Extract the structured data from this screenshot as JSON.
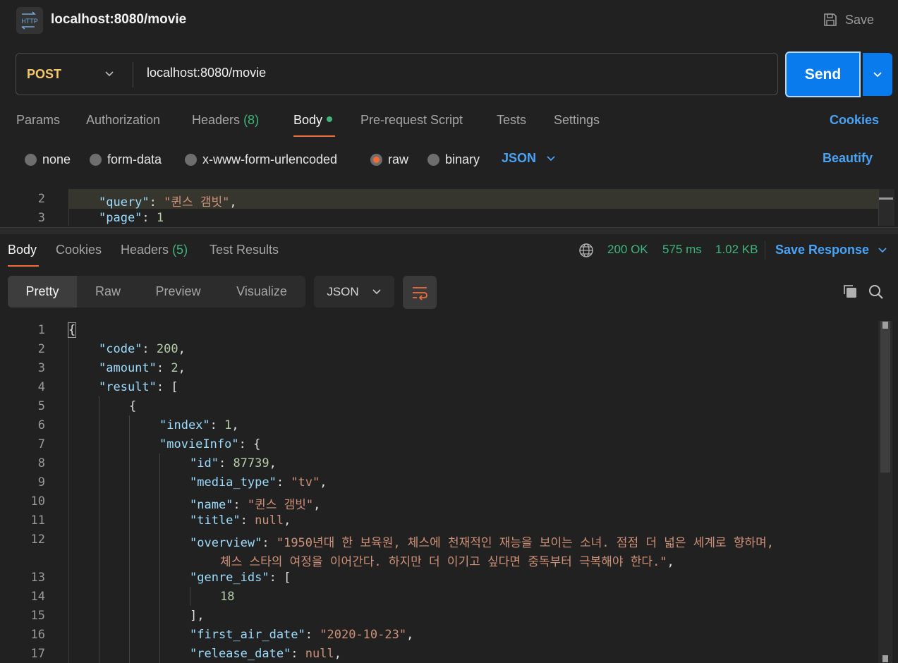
{
  "header": {
    "title": "localhost:8080/movie",
    "save_label": "Save",
    "icon_text": "HTTP"
  },
  "request": {
    "method": "POST",
    "url": "localhost:8080/movie",
    "send_label": "Send",
    "tabs": [
      {
        "label": "Params"
      },
      {
        "label": "Authorization"
      },
      {
        "label": "Headers",
        "count": "(8)"
      },
      {
        "label": "Body"
      },
      {
        "label": "Pre-request Script"
      },
      {
        "label": "Tests"
      },
      {
        "label": "Settings"
      }
    ],
    "cookies_label": "Cookies",
    "body_types": [
      "none",
      "form-data",
      "x-www-form-urlencoded",
      "raw",
      "binary"
    ],
    "selected_body_type": "raw",
    "format": "JSON",
    "beautify_label": "Beautify",
    "editor_lines": [
      {
        "num": "2",
        "key": "\"query\"",
        "value": "\"퀸스 갬빗\"",
        "tail": ","
      },
      {
        "num": "3",
        "key": "\"page\"",
        "value": "1",
        "tail": ""
      }
    ]
  },
  "response": {
    "tabs": [
      {
        "label": "Body"
      },
      {
        "label": "Cookies"
      },
      {
        "label": "Headers",
        "count": "(5)"
      },
      {
        "label": "Test Results"
      }
    ],
    "status": "200 OK",
    "time": "575 ms",
    "size": "1.02 KB",
    "save_response_label": "Save Response",
    "view_modes": [
      "Pretty",
      "Raw",
      "Preview",
      "Visualize"
    ],
    "format": "JSON",
    "lines": [
      {
        "num": "1",
        "text": "{"
      },
      {
        "num": "2",
        "key": "\"code\"",
        "value": "200",
        "vtype": "n",
        "tail": ","
      },
      {
        "num": "3",
        "key": "\"amount\"",
        "value": "2",
        "vtype": "n",
        "tail": ","
      },
      {
        "num": "4",
        "key": "\"result\"",
        "value": "[",
        "vtype": "p",
        "tail": ""
      },
      {
        "num": "5",
        "text": "{"
      },
      {
        "num": "6",
        "key": "\"index\"",
        "value": "1",
        "vtype": "n",
        "tail": ","
      },
      {
        "num": "7",
        "key": "\"movieInfo\"",
        "value": "{",
        "vtype": "p",
        "tail": ""
      },
      {
        "num": "8",
        "key": "\"id\"",
        "value": "87739",
        "vtype": "n",
        "tail": ","
      },
      {
        "num": "9",
        "key": "\"media_type\"",
        "value": "\"tv\"",
        "vtype": "s",
        "tail": ","
      },
      {
        "num": "10",
        "key": "\"name\"",
        "value": "\"퀸스 갬빗\"",
        "vtype": "s",
        "tail": ","
      },
      {
        "num": "11",
        "key": "\"title\"",
        "value": "null",
        "vtype": "kw",
        "tail": ","
      },
      {
        "num": "12",
        "key": "\"overview\"",
        "value": "\"1950년대 한 보육원, 체스에 천재적인 재능을 보이는 소녀. 점점 더 넓은 세계로 향하며,",
        "vtype": "s",
        "tail": ""
      },
      {
        "num": "",
        "value": "체스 스타의 여정을 이어간다. 하지만 더 이기고 싶다면 중독부터 극복해야 한다.\"",
        "vtype": "s",
        "tail": ","
      },
      {
        "num": "13",
        "key": "\"genre_ids\"",
        "value": "[",
        "vtype": "p",
        "tail": ""
      },
      {
        "num": "14",
        "value": "18",
        "vtype": "n",
        "tail": ""
      },
      {
        "num": "15",
        "text": "],"
      },
      {
        "num": "16",
        "key": "\"first_air_date\"",
        "value": "\"2020-10-23\"",
        "vtype": "s",
        "tail": ","
      },
      {
        "num": "17",
        "key": "\"release_date\"",
        "value": "null",
        "vtype": "kw",
        "tail": ","
      }
    ]
  }
}
